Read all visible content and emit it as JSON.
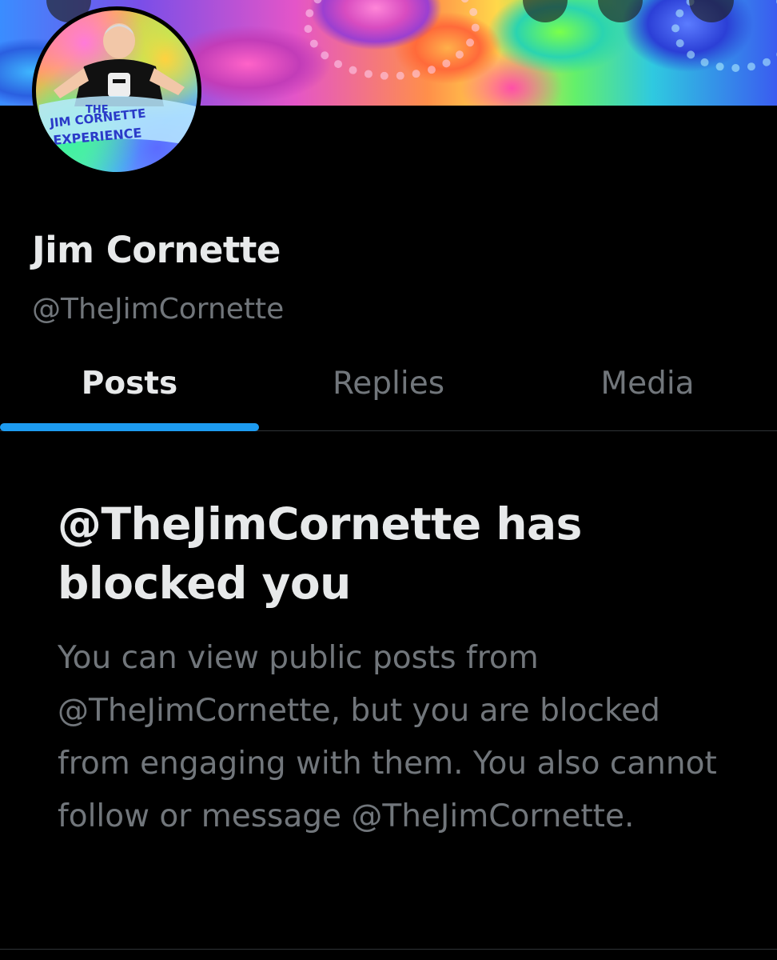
{
  "profile": {
    "display_name": "Jim Cornette",
    "handle": "@TheJimCornette",
    "avatar_icon": "profile-avatar-image",
    "avatar_text": [
      "THE",
      "JIM CORNETTE",
      "EXPERIENCE"
    ]
  },
  "tabs": [
    {
      "label": "Posts",
      "active": true
    },
    {
      "label": "Replies",
      "active": false
    },
    {
      "label": "Media",
      "active": false
    }
  ],
  "blocked": {
    "title": "@TheJimCornette has blocked you",
    "body": "You can view public posts from @TheJimCornette, but you are blocked from engaging with them. You also cannot follow or message @TheJimCornette."
  },
  "colors": {
    "background": "#000000",
    "text_primary": "#e7e9ea",
    "text_secondary": "#71767b",
    "accent": "#1d9bf0",
    "divider": "#2f3336"
  }
}
